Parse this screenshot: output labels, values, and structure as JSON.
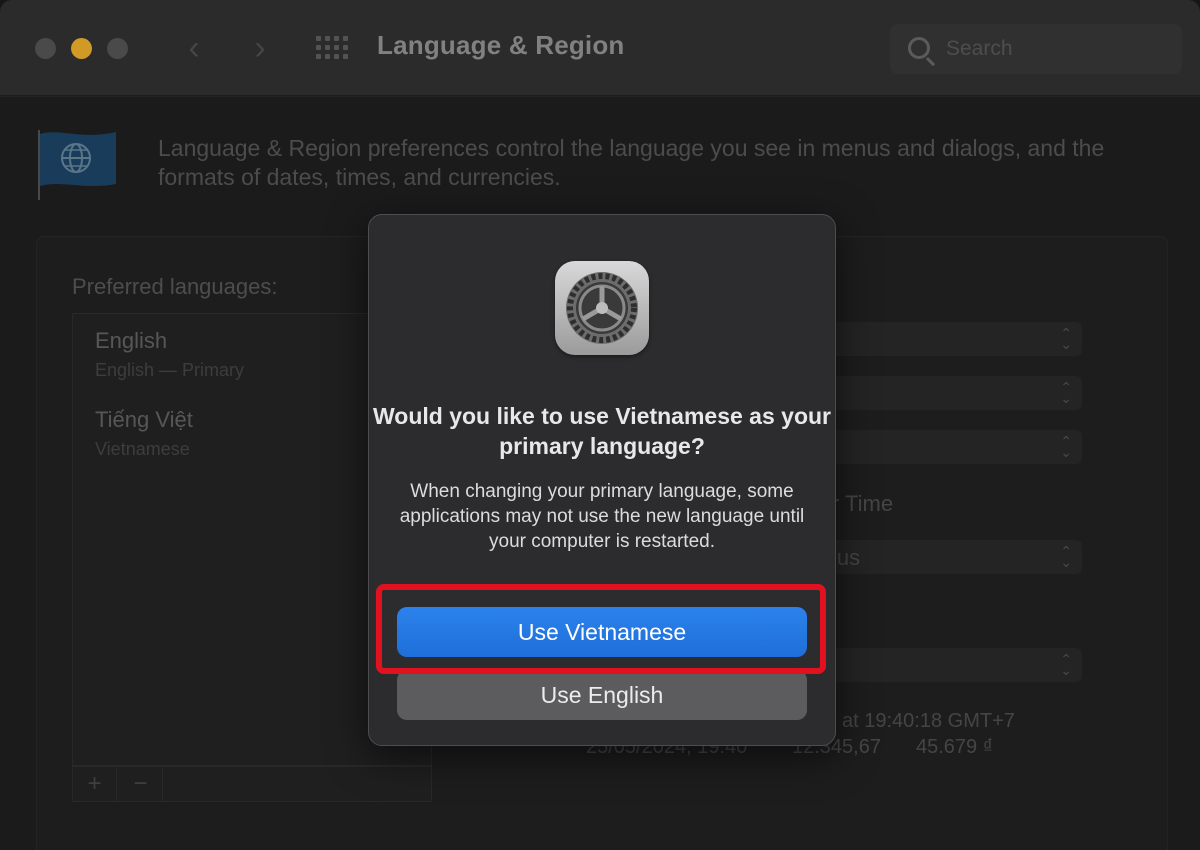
{
  "window": {
    "title": "Language & Region",
    "search_placeholder": "Search"
  },
  "header": {
    "description": "Language & Region preferences control the language you see in menus and dialogs, and the formats of dates, times, and currencies."
  },
  "preferred_languages": {
    "label": "Preferred languages:",
    "items": [
      {
        "name": "English",
        "subtitle": "English — Primary"
      },
      {
        "name": "Tiếng Việt",
        "subtitle": "Vietnamese"
      }
    ],
    "add_label": "+",
    "remove_label": "−"
  },
  "background_fragments": {
    "time_label": "r Time",
    "temperature_value": "ius",
    "time_sample": "at 19:40:18 GMT+7",
    "format_date": "25/05/2024, 19:40",
    "format_number": "12.345,67",
    "format_currency": "45.679 ₫"
  },
  "dialog": {
    "title": "Would you like to use Vietnamese as your primary language?",
    "body": "When changing your primary language, some applications may not use the new language until your computer is restarted.",
    "primary_button": "Use Vietnamese",
    "secondary_button": "Use English"
  },
  "colors": {
    "accent_blue": "#2c82ec",
    "highlight_red": "#e01220",
    "minimize_yellow": "#febc2e"
  },
  "icons": {
    "app_icon": "system-preferences-gear-icon",
    "flag": "globe-flag-icon"
  }
}
